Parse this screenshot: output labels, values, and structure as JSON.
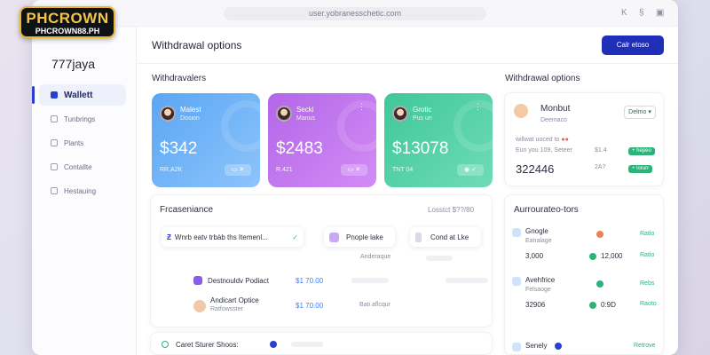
{
  "logo": {
    "main": "PHCROWN",
    "sub": "PHCROWN88.PH"
  },
  "browser": {
    "url": "user.yobranesschetic.com",
    "controls": [
      "K",
      "§",
      "▣"
    ]
  },
  "sidebar": {
    "brand": "777jaya",
    "items": [
      {
        "label": "Wallett",
        "active": true
      },
      {
        "label": "Tunbrings"
      },
      {
        "label": "Plants"
      },
      {
        "label": "Contallte"
      },
      {
        "label": "Hestauing"
      }
    ]
  },
  "header": {
    "title": "Withdrawal options",
    "button": "Calr etoso"
  },
  "sections": {
    "left_title": "Withdravalers",
    "right_title": "Withdrawal options"
  },
  "cards": [
    {
      "name": "Malest",
      "sub": "Dosion",
      "amount": "$342",
      "foot": "RR.A2K",
      "color_a": "#5aa6f4",
      "color_b": "#8dc4fb"
    },
    {
      "name": "Secki",
      "sub": "Manus",
      "amount": "$2483",
      "foot": "R.421",
      "color_a": "#b366e8",
      "color_b": "#d28cf5"
    },
    {
      "name": "Grotic",
      "sub": "Pus un",
      "amount": "$13078",
      "foot": "TNT 04",
      "color_a": "#3fc79a",
      "color_b": "#6fdcb6"
    }
  ],
  "preference": {
    "title": "Frcaseniance",
    "right_label": "Losstct  $??/80",
    "chip1": "Wnrb eatv trbàb ths Itemenl...",
    "chip2": "Pnople lake",
    "chip3": "Cond at Lke",
    "sub_label": "Anderaque",
    "rows": [
      {
        "label": "Destnouldv Podiact",
        "sub": "",
        "value": "$1 70.00"
      },
      {
        "label": "Andicart Optice",
        "sub": "Ratfowsster",
        "value": "$1 70.00",
        "extra": "Bati aflcqur"
      }
    ]
  },
  "bottom_card": {
    "label": "Caret Sturer Shoos:"
  },
  "right_panel": {
    "name": "Monbut",
    "sub": "Deemaco",
    "select": "Delmo",
    "meta": "willwat uoced to",
    "meta2": "Eun you 109, Seteer",
    "amount": "322446",
    "v1": "$1.4",
    "v2": "2A?",
    "tag1": "+ hepeo",
    "tag2": "+ lorurr"
  },
  "accounts": {
    "title": "Aurrourateo-tors",
    "rows": [
      {
        "name": "Gnogle",
        "sub": "Eanalage",
        "amount": "3,000",
        "value": "12,000",
        "status": "Ratio",
        "status_top": "Ratio"
      },
      {
        "name": "Avehfrice",
        "sub": "Felsaoge",
        "amount": "32906",
        "value": "0:9D",
        "status": "Raoto",
        "status_top": "Rebs"
      },
      {
        "name": "Senely",
        "sub": "",
        "amount": "",
        "value": "",
        "status": "Retrove",
        "status_top": ""
      }
    ]
  }
}
